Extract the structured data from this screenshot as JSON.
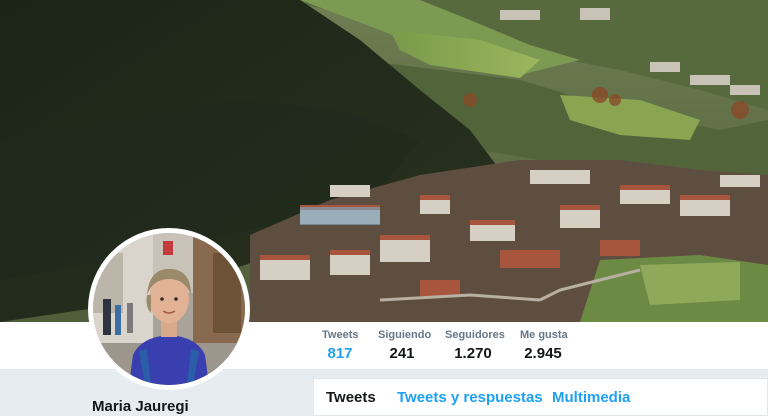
{
  "profile": {
    "name": "Maria Jauregi"
  },
  "stats": [
    {
      "label": "Tweets",
      "value": "817"
    },
    {
      "label": "Siguiendo",
      "value": "241"
    },
    {
      "label": "Seguidores",
      "value": "1.270"
    },
    {
      "label": "Me gusta",
      "value": "2.945"
    }
  ],
  "tabs": [
    {
      "label": "Tweets"
    },
    {
      "label": "Tweets y respuestas"
    },
    {
      "label": "Multimedia"
    }
  ],
  "colors": {
    "accent": "#1da1f2",
    "text_primary": "#14171a",
    "text_secondary": "#657786",
    "background": "#e6ecf0"
  }
}
